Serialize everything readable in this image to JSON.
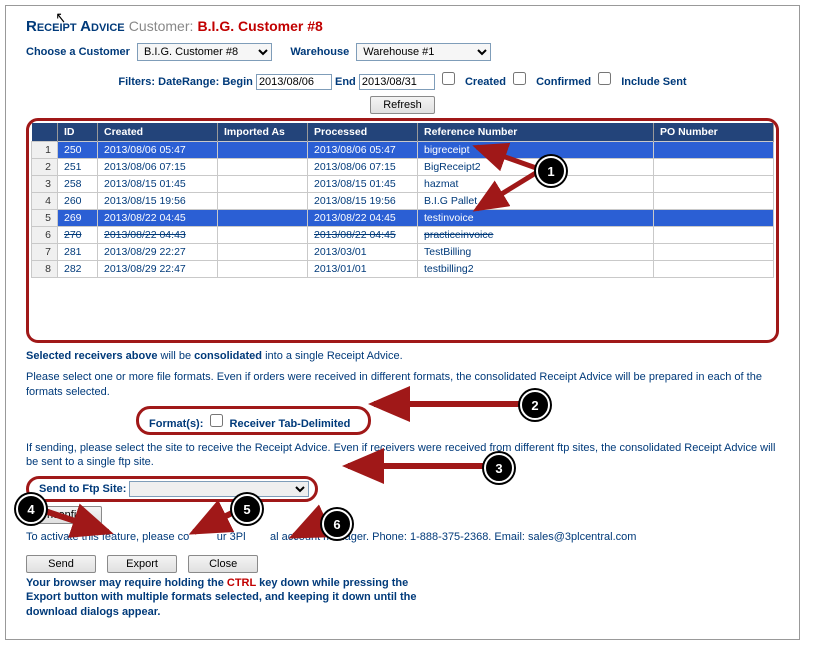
{
  "header": {
    "page_title": "Receipt Advice",
    "customer_label": "Customer:",
    "customer_name": "B.I.G. Customer #8"
  },
  "selectors": {
    "customer_label": "Choose a Customer",
    "customer_value": "B.I.G. Customer #8",
    "warehouse_label": "Warehouse",
    "warehouse_value": "Warehouse #1"
  },
  "filters": {
    "label": "Filters: DateRange: Begin",
    "begin": "2013/08/06",
    "end_label": "End",
    "end": "2013/08/31",
    "created": "Created",
    "confirmed": "Confirmed",
    "include_sent": "Include Sent",
    "refresh": "Refresh"
  },
  "grid": {
    "headers": [
      "",
      "ID",
      "Created",
      "Imported As",
      "Processed",
      "Reference Number",
      "PO Number"
    ],
    "rows": [
      {
        "n": "1",
        "id": "250",
        "created": "2013/08/06 05:47",
        "imported": "",
        "processed": "2013/08/06 05:47",
        "ref": "bigreceipt",
        "po": "",
        "sel": true
      },
      {
        "n": "2",
        "id": "251",
        "created": "2013/08/06 07:15",
        "imported": "",
        "processed": "2013/08/06 07:15",
        "ref": "BigReceipt2",
        "po": "",
        "sel": false
      },
      {
        "n": "3",
        "id": "258",
        "created": "2013/08/15 01:45",
        "imported": "",
        "processed": "2013/08/15 01:45",
        "ref": "hazmat",
        "po": "",
        "sel": false
      },
      {
        "n": "4",
        "id": "260",
        "created": "2013/08/15 19:56",
        "imported": "",
        "processed": "2013/08/15 19:56",
        "ref": "B.I.G Pallet",
        "po": "",
        "sel": false
      },
      {
        "n": "5",
        "id": "269",
        "created": "2013/08/22 04:45",
        "imported": "",
        "processed": "2013/08/22 04:45",
        "ref": "testinvoice",
        "po": "",
        "sel": true
      },
      {
        "n": "6",
        "id": "270",
        "created": "2013/08/22 04:43",
        "imported": "",
        "processed": "2013/08/22 04:45",
        "ref": "practiceinvoice",
        "po": "",
        "sel": false,
        "struck": true
      },
      {
        "n": "7",
        "id": "281",
        "created": "2013/08/29 22:27",
        "imported": "",
        "processed": "2013/03/01",
        "ref": "TestBilling",
        "po": "",
        "sel": false
      },
      {
        "n": "8",
        "id": "282",
        "created": "2013/08/29 22:47",
        "imported": "",
        "processed": "2013/01/01",
        "ref": "testbilling2",
        "po": "",
        "sel": false
      }
    ]
  },
  "messages": {
    "consolidation_a": "Selected receivers above",
    "consolidation_b": " will be ",
    "consolidation_c": "consolidated",
    "consolidation_d": " into a single Receipt Advice.",
    "formats_help": "Please select one or more file formats. Even if orders were received in different formats, the consolidated Receipt Advice will be prepared in each of the formats selected.",
    "ftp_help": "If sending, please select the site to receive the Receipt Advice. Even if receivers were received from different ftp sites, the consolidated Receipt Advice will be sent to a single ftp site.",
    "activate_a": "To activate this feature, please co",
    "activate_b": "ur 3Pl",
    "activate_c": "al account manager. Phone: 1-888-375-2368. Email: sales@3plcentral.com",
    "footer_a": "Your browser may require holding the ",
    "footer_ctrl": "CTRL",
    "footer_b": " key down while pressing the Export button with multiple formats selected, and keeping it down until the download dialogs appear."
  },
  "formats": {
    "label": "Format(s):",
    "option": "Receiver Tab-Delimited"
  },
  "ftp": {
    "label": "Send to Ftp Site:"
  },
  "buttons": {
    "unconfirm": "Unconfirm",
    "send": "Send",
    "export": "Export",
    "close": "Close"
  },
  "annotations": {
    "b1": "1",
    "b2": "2",
    "b3": "3",
    "b4": "4",
    "b5": "5",
    "b6": "6"
  }
}
